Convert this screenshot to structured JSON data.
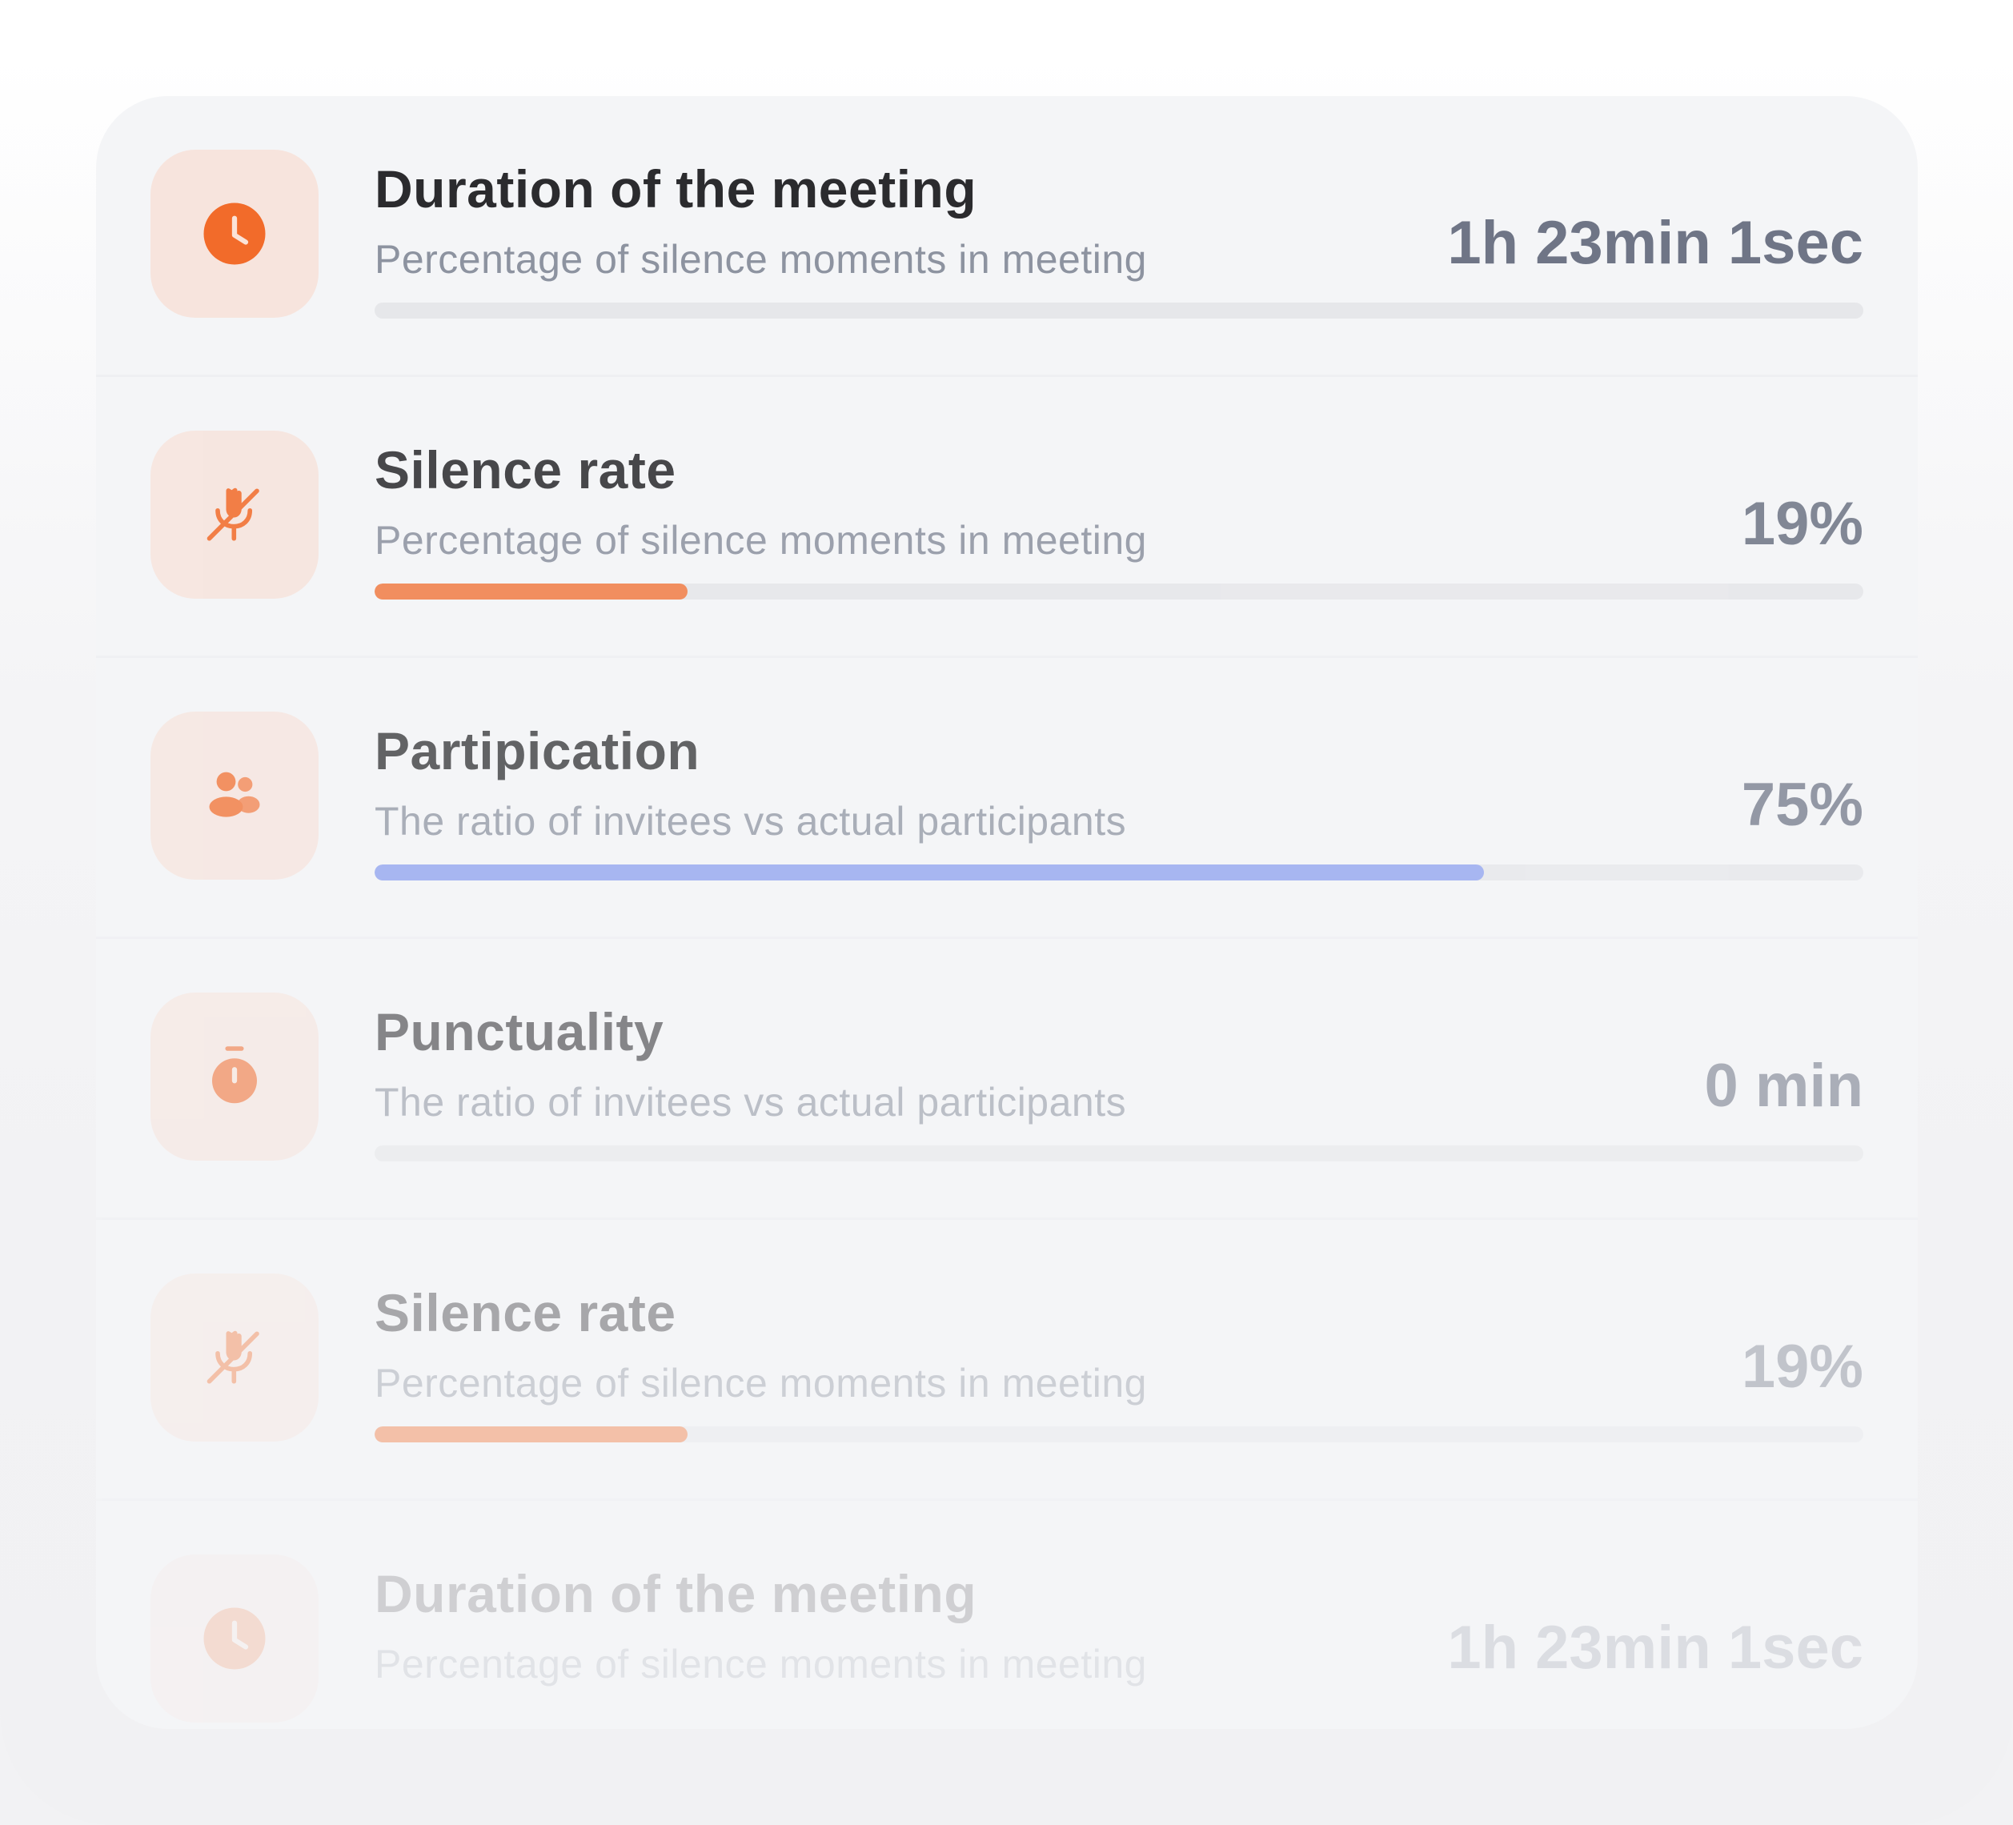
{
  "colors": {
    "accent_orange": "#f26b2a",
    "accent_blue": "#8a9ff0",
    "tile_background": "#f7e4dd",
    "track": "#e6e7ea"
  },
  "metrics": [
    {
      "title": "Duration of the meeting",
      "subtitle": "Percentage of silence moments in meeting",
      "value": "1h 23min 1sec",
      "icon": "clock-icon",
      "progress": 0,
      "bar_color": "#f26b2a"
    },
    {
      "title": "Silence rate",
      "subtitle": "Percentage of silence moments in meeting",
      "value": "19%",
      "icon": "mic-off-icon",
      "progress": 0.21,
      "bar_color": "#f26b2a"
    },
    {
      "title": "Partipication",
      "subtitle": "The ratio of invitees vs actual participants",
      "value": "75%",
      "icon": "users-icon",
      "progress": 0.745,
      "bar_color": "#8a9ff0"
    },
    {
      "title": "Punctuality",
      "subtitle": "The ratio of invitees vs actual participants",
      "value": "0 min",
      "icon": "stopwatch-icon",
      "progress": 0,
      "bar_color": "#f26b2a"
    },
    {
      "title": "Silence rate",
      "subtitle": "Percentage of silence moments in meeting",
      "value": "19%",
      "icon": "mic-off-icon",
      "progress": 0.21,
      "bar_color": "#f26b2a"
    },
    {
      "title": "Duration of the meeting",
      "subtitle": "Percentage of silence moments in meeting",
      "value": "1h 23min 1sec",
      "icon": "clock-icon",
      "progress": 0,
      "bar_color": "#f26b2a"
    }
  ]
}
